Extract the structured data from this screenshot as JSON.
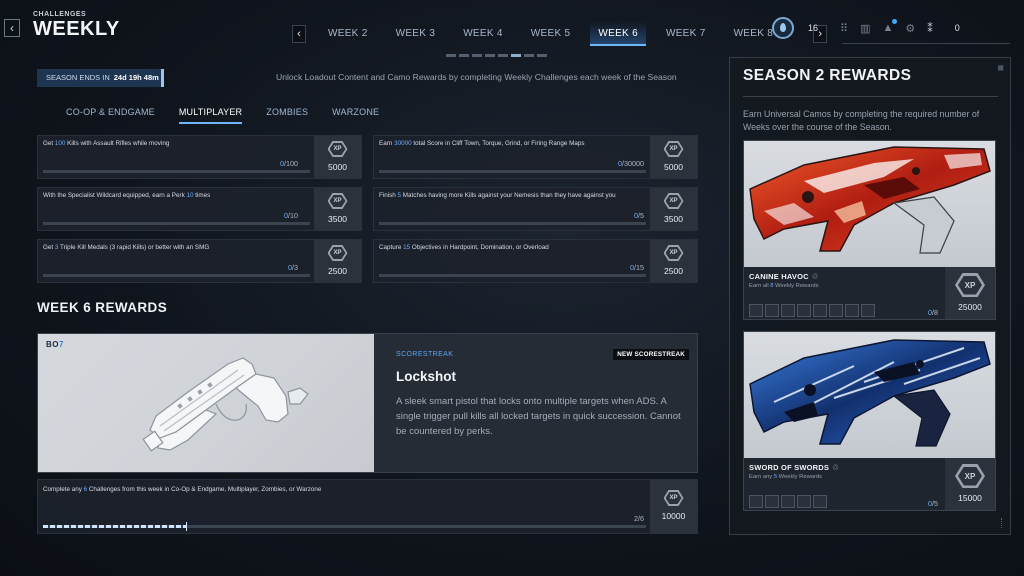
{
  "header": {
    "breadcrumb": "CHALLENGES",
    "title": "WEEKLY",
    "back_icon": "chevron-left-icon",
    "weeks": [
      "WEEK 2",
      "WEEK 3",
      "WEEK 4",
      "WEEK 5",
      "WEEK 6",
      "WEEK 7",
      "WEEK 8"
    ],
    "active_week": "WEEK 6",
    "prev_arrow": "‹",
    "next_arrow": "›",
    "cod_points": "16",
    "friends_online": "0"
  },
  "season": {
    "ends_label": "SEASON ENDS IN",
    "ends_value": "24d 19h 48m",
    "intro": "Unlock Loadout Content and Camo Rewards by completing Weekly Challenges each week of the Season"
  },
  "modes": {
    "tabs": [
      "CO-OP & ENDGAME",
      "MULTIPLAYER",
      "ZOMBIES",
      "WARZONE"
    ],
    "active": "MULTIPLAYER"
  },
  "challenges": [
    {
      "pre": "Get ",
      "hl": "100",
      "post": " Kills with Assault Rifles while moving",
      "current": "0",
      "total": "/100",
      "progress": 0,
      "xp": "5000",
      "xp_label": "XP"
    },
    {
      "pre": "Earn ",
      "hl": "30000",
      "post": " total Score in Cliff Town, Torque, Grind, or Firing Range Maps",
      "current": "0",
      "total": "/30000",
      "progress": 0,
      "xp": "5000",
      "xp_label": "XP"
    },
    {
      "pre": "With the Specialist Wildcard equipped, earn a Perk ",
      "hl": "10",
      "post": " times",
      "current": "0",
      "total": "/10",
      "progress": 0,
      "xp": "3500",
      "xp_label": "XP"
    },
    {
      "pre": "Finish ",
      "hl": "5",
      "post": " Matches having more Kills against your Nemesis than they have against you",
      "current": "0",
      "total": "/5",
      "progress": 0,
      "xp": "3500",
      "xp_label": "XP"
    },
    {
      "pre": "Get ",
      "hl": "3",
      "post": " Triple Kill Medals (3 rapid Kills) or better with an SMG",
      "current": "0",
      "total": "/3",
      "progress": 0,
      "xp": "2500",
      "xp_label": "XP"
    },
    {
      "pre": "Capture ",
      "hl": "15",
      "post": " Objectives in Hardpoint, Domination, or Overload",
      "current": "0",
      "total": "/15",
      "progress": 0,
      "xp": "2500",
      "xp_label": "XP"
    }
  ],
  "week_rewards": {
    "heading": "WEEK 6 REWARDS",
    "logo_text": "BO",
    "logo_accent": "7",
    "type": "SCORESTREAK",
    "badge": "NEW SCORESTREAK",
    "name": "Lockshot",
    "description": "A sleek smart pistol that locks onto multiple targets when ADS. A single trigger pull kills all locked targets in quick succession. Cannot be countered by perks.",
    "final": {
      "pre": "Complete any ",
      "hl": "6",
      "post": " Challenges from this week in Co-Op & Endgame, Multiplayer, Zombies, or Warzone",
      "current": "2",
      "total": "/6",
      "progress": 0.33,
      "xp": "10000",
      "xp_label": "XP"
    }
  },
  "season_rewards": {
    "title": "SEASON 2 REWARDS",
    "description": "Earn Universal Camos by completing the required number of Weeks over the course of the Season.",
    "camos": [
      {
        "name": "CANINE HAVOC",
        "sub_pre": "Earn all ",
        "sub_hl": "8",
        "sub_post": " Weekly Rewards",
        "current": "0",
        "total": "/8",
        "slots": 8,
        "xp": "25000",
        "xp_label": "XP"
      },
      {
        "name": "SWORD OF SWORDS",
        "sub_pre": "Earn any ",
        "sub_hl": "5",
        "sub_post": " Weekly Rewards",
        "current": "0",
        "total": "/5",
        "slots": 5,
        "xp": "15000",
        "xp_label": "XP"
      }
    ]
  }
}
